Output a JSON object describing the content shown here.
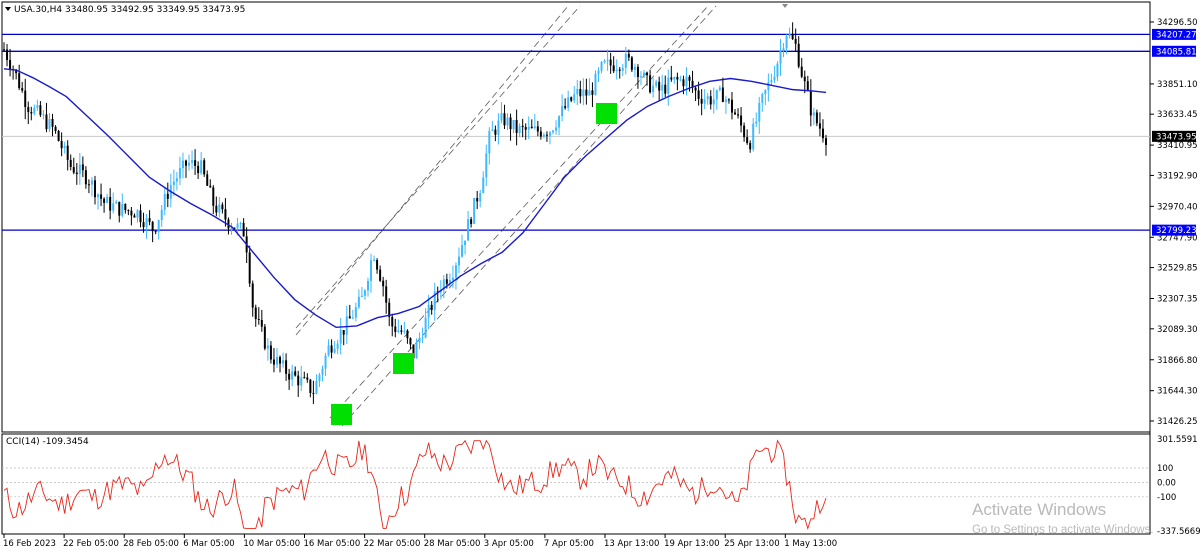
{
  "header": {
    "symbol_line": "USA.30,H4  33480.95 33492.95 33349.95 33473.95"
  },
  "price_axis": {
    "ticks": [
      "34296.50",
      "33851.10",
      "33633.45",
      "33410.95",
      "33192.90",
      "32970.40",
      "32747.90",
      "32529.85",
      "32307.35",
      "32089.30",
      "31866.80",
      "31644.30",
      "31426.25"
    ],
    "labels": [
      {
        "text": "34207.27",
        "price": 34207.27,
        "color": "#0000ff"
      },
      {
        "text": "34085.81",
        "price": 34085.81,
        "color": "#0000ff"
      },
      {
        "text": "33473.95",
        "price": 33473.95,
        "color": "#000000"
      },
      {
        "text": "32799.23",
        "price": 32799.23,
        "color": "#0000ff"
      }
    ]
  },
  "hlines": [
    {
      "price": 34207.27,
      "color": "#0000cc"
    },
    {
      "price": 34085.81,
      "color": "#0000cc"
    },
    {
      "price": 32799.23,
      "color": "#0000cc"
    }
  ],
  "time_axis": {
    "labels": [
      "16 Feb 2023",
      "22 Feb 05:00",
      "28 Feb 05:00",
      "6 Mar 05:00",
      "10 Mar 05:00",
      "16 Mar 05:00",
      "22 Mar 05:00",
      "28 Mar 05:00",
      "3 Apr 05:00",
      "7 Apr 05:00",
      "13 Apr 13:00",
      "19 Apr 13:00",
      "25 Apr 13:00",
      "1 May 13:00"
    ]
  },
  "indicator": {
    "label": "CCI(14) -109.3454",
    "ticks": [
      "301.5591",
      "100",
      "0.00",
      "-100",
      "-337.5669"
    ]
  },
  "watermark": {
    "line1": "Activate Windows",
    "line2": "Go to Settings to activate Windows."
  },
  "colors": {
    "bull_candle": "#3db9ff",
    "bear_candle": "#000000",
    "moving_average": "#1a1acc",
    "cci_line": "#e8261a",
    "signal_box": "#00e000",
    "channel_lines": "#5a5a5a"
  },
  "moving_average": {
    "description_free": true,
    "points": [
      [
        0,
        33960
      ],
      [
        6,
        33950
      ],
      [
        14,
        33895
      ],
      [
        22,
        33830
      ],
      [
        30,
        33760
      ],
      [
        40,
        33620
      ],
      [
        50,
        33480
      ],
      [
        60,
        33330
      ],
      [
        70,
        33180
      ],
      [
        80,
        33080
      ],
      [
        90,
        32990
      ],
      [
        100,
        32910
      ],
      [
        110,
        32820
      ],
      [
        120,
        32640
      ],
      [
        130,
        32460
      ],
      [
        140,
        32300
      ],
      [
        150,
        32190
      ],
      [
        160,
        32100
      ],
      [
        170,
        32110
      ],
      [
        180,
        32170
      ],
      [
        190,
        32200
      ],
      [
        200,
        32250
      ],
      [
        210,
        32360
      ],
      [
        220,
        32470
      ],
      [
        230,
        32560
      ],
      [
        240,
        32640
      ],
      [
        250,
        32780
      ],
      [
        260,
        32980
      ],
      [
        270,
        33180
      ],
      [
        280,
        33330
      ],
      [
        290,
        33460
      ],
      [
        300,
        33590
      ],
      [
        310,
        33690
      ],
      [
        320,
        33760
      ],
      [
        330,
        33820
      ],
      [
        340,
        33870
      ],
      [
        350,
        33890
      ],
      [
        360,
        33870
      ],
      [
        370,
        33840
      ],
      [
        380,
        33810
      ],
      [
        390,
        33800
      ],
      [
        396,
        33790
      ]
    ]
  }
}
